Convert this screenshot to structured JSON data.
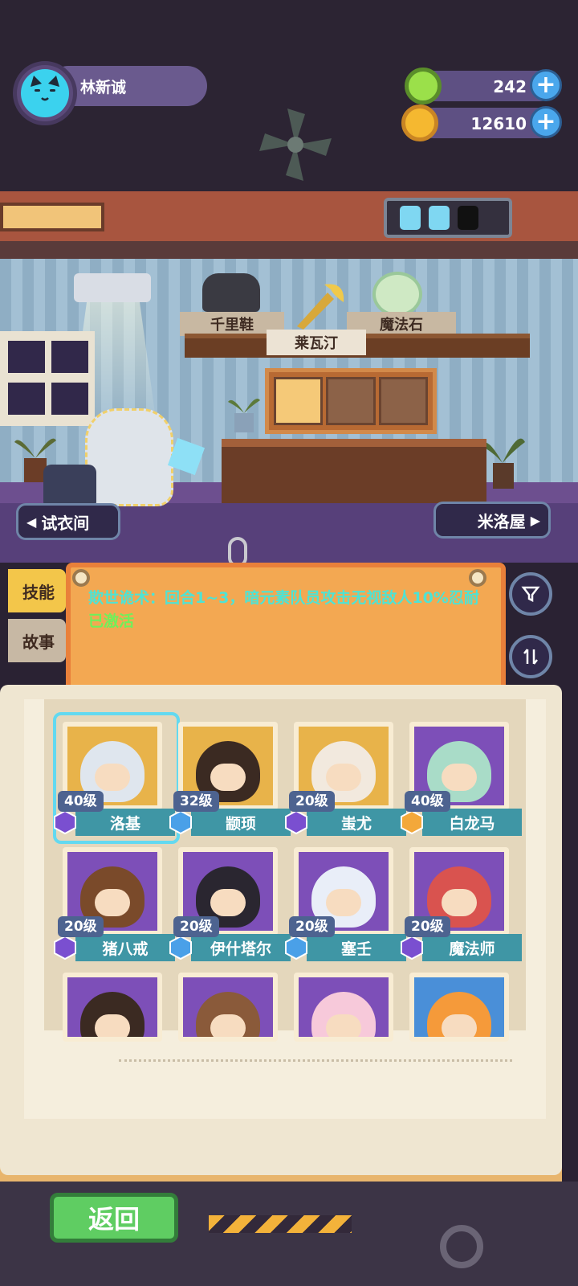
{
  "player": {
    "name": "林新诚"
  },
  "currency": [
    {
      "icon": "green-gem-coin-icon",
      "amount": "242",
      "color": "#9be04a"
    },
    {
      "icon": "gold-planet-coin-icon",
      "amount": "12610",
      "color": "#f5b830"
    }
  ],
  "room": {
    "shelf_items": [
      {
        "label": "千里鞋",
        "icon": "shoe-icon"
      },
      {
        "label": "莱瓦汀",
        "icon": "golden-sword-icon"
      },
      {
        "label": "魔法石",
        "icon": "magic-orb-icon"
      }
    ],
    "left_nav": "试衣间",
    "right_nav": "米洛屋"
  },
  "side_tabs": {
    "skill": "技能",
    "story": "故事"
  },
  "skill": {
    "text": "欺世诡术：回合1~3，暗元素队员攻击无视敌人10%忍耐",
    "status": "已激活"
  },
  "characters": [
    {
      "level": "40级",
      "name": "洛基",
      "element": "dark",
      "color": "#e8b34a",
      "hair": "#dfe6ee",
      "selected": true
    },
    {
      "level": "32级",
      "name": "颛顼",
      "element": "water",
      "color": "#e8b34a",
      "hair": "#3b2a22",
      "selected": false
    },
    {
      "level": "20级",
      "name": "蚩尤",
      "element": "dark",
      "color": "#e8b34a",
      "hair": "#f2e9de",
      "selected": false
    },
    {
      "level": "40级",
      "name": "白龙马",
      "element": "light",
      "color": "#7d4fb8",
      "hair": "#a9dcc8",
      "selected": false
    },
    {
      "level": "20级",
      "name": "猪八戒",
      "element": "dark",
      "color": "#7d4fb8",
      "hair": "#7a4a2a",
      "selected": false
    },
    {
      "level": "20级",
      "name": "伊什塔尔",
      "element": "water",
      "color": "#7d4fb8",
      "hair": "#2a2630",
      "selected": false
    },
    {
      "level": "20级",
      "name": "塞壬",
      "element": "water",
      "color": "#7d4fb8",
      "hair": "#e9eef8",
      "selected": false
    },
    {
      "level": "20级",
      "name": "魔法师",
      "element": "dark",
      "color": "#7d4fb8",
      "hair": "#d9534f",
      "selected": false
    },
    {
      "level": "",
      "name": "",
      "element": "",
      "color": "#7d4fb8",
      "hair": "#3b2a22",
      "selected": false
    },
    {
      "level": "",
      "name": "",
      "element": "",
      "color": "#7d4fb8",
      "hair": "#8a5a3a",
      "selected": false
    },
    {
      "level": "",
      "name": "",
      "element": "",
      "color": "#7d4fb8",
      "hair": "#f7c9da",
      "selected": false
    },
    {
      "level": "",
      "name": "",
      "element": "",
      "color": "#4a8fd8",
      "hair": "#f59a3a",
      "selected": false
    }
  ],
  "buttons": {
    "return": "返回"
  },
  "colors": {
    "skill_text": "#4ee3d4",
    "active_text": "#6ff05a",
    "name_bar": "#3f96a5"
  }
}
